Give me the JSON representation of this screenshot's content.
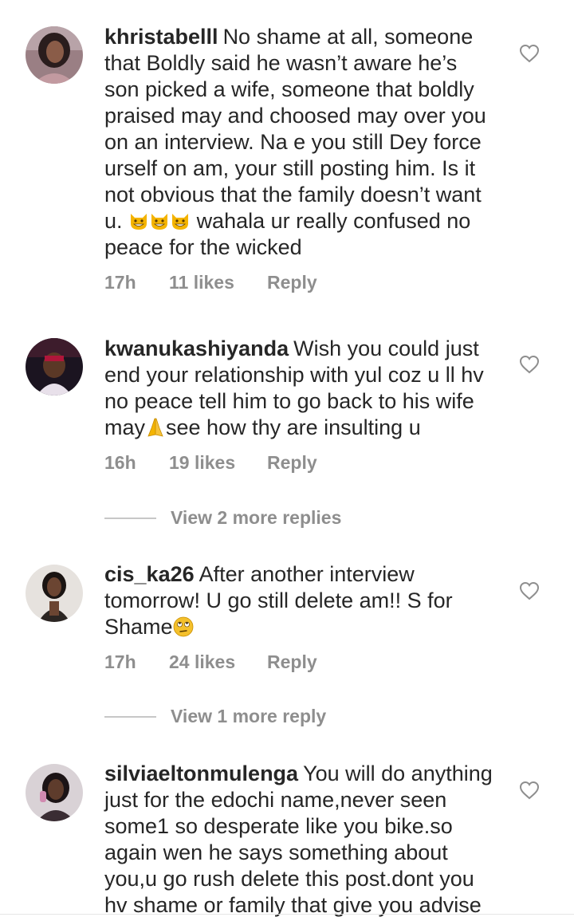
{
  "comments": [
    {
      "username": "khristabelll",
      "text_lines": [
        "No shame at all, someone",
        "that Boldly said he wasn’t aware he’s",
        "son picked a wife, someone that boldly",
        "praised may and choosed may over you",
        "on an interview. Na e you still Dey force",
        "urself on am, your still posting him. Is it",
        "not obvious that the family doesn’t want",
        "u.",
        "wahala ur really confused no",
        "peace for the wicked"
      ],
      "time": "17h",
      "likes": "11 likes",
      "reply": "Reply",
      "emoji": "grinning-cat-emoji"
    },
    {
      "username": "kwanukashiyanda",
      "text_lines": [
        "Wish you could just",
        "end your relationship with yul coz u ll hv",
        "no peace tell him to go back to his wife",
        "may",
        "see how thy are insulting u"
      ],
      "time": "16h",
      "likes": "19 likes",
      "reply": "Reply",
      "emoji": "folded-hands-emoji",
      "view_more": "View 2 more replies"
    },
    {
      "username": "cis_ka26",
      "text_lines": [
        "After another interview",
        "tomorrow! U go still delete am!! S for",
        "Shame"
      ],
      "time": "17h",
      "likes": "24 likes",
      "reply": "Reply",
      "emoji": "eye-roll-emoji",
      "view_more": "View 1 more reply"
    },
    {
      "username": "silviaeltonmulenga",
      "text_lines": [
        "You will do anything",
        "just for the edochi name,never seen",
        "some1 so desperate like you bike.so",
        "again wen he says something about",
        "you,u go rush delete this post.dont you",
        "hv shame or family that give you advise"
      ]
    }
  ],
  "icons": {
    "like": "heart-outline-icon"
  },
  "colors": {
    "text": "#262626",
    "meta": "#8e8e8e",
    "heart": "#8e8e8e"
  }
}
